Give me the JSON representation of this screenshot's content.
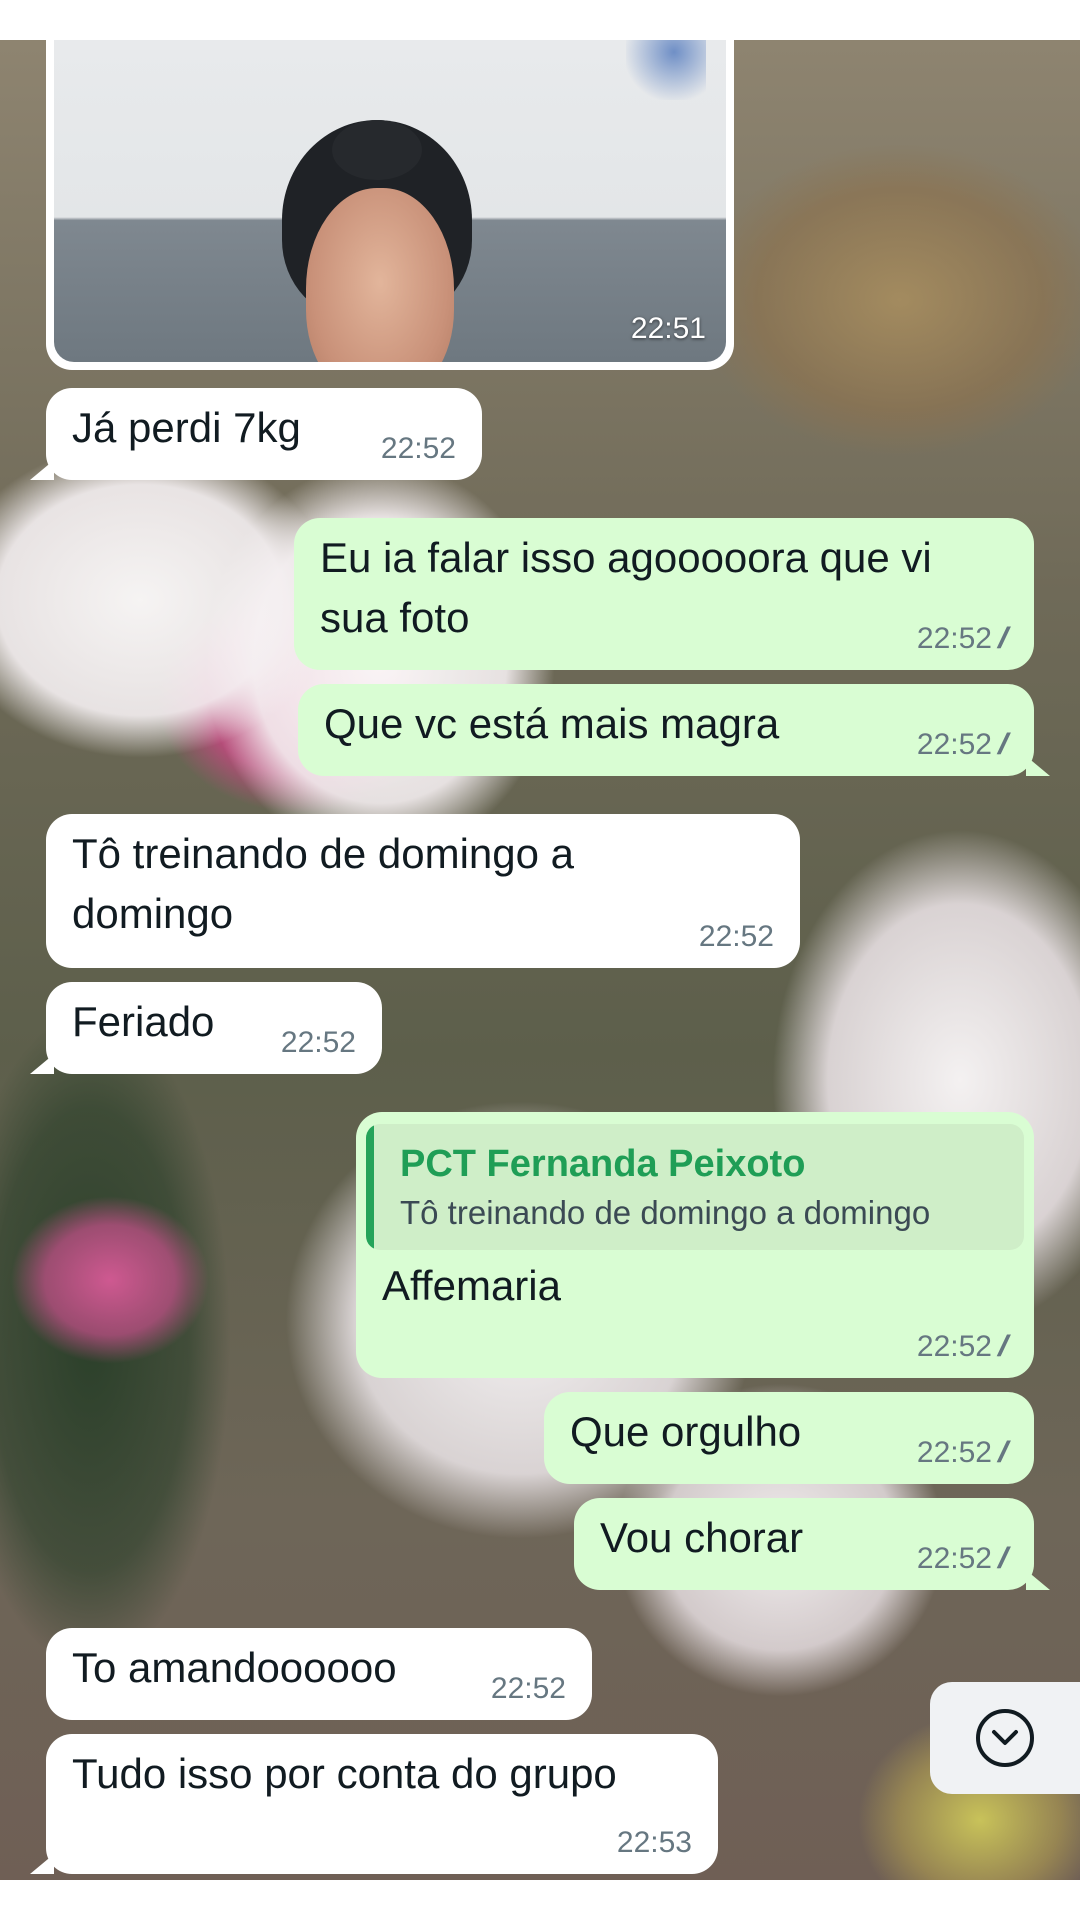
{
  "chat": {
    "photo_message": {
      "time": "22:51"
    },
    "messages": [
      {
        "direction": "in",
        "text": "Já perdi 7kg",
        "time": "22:52"
      },
      {
        "direction": "out",
        "text_line1": "Eu ia falar isso agooooora que vi",
        "text_line2": "sua foto",
        "time": "22:52",
        "status": "read"
      },
      {
        "direction": "out",
        "text": "Que vc está mais magra",
        "time": "22:52",
        "status": "read"
      },
      {
        "direction": "in",
        "text_line1": "Tô treinando de domingo a",
        "text_line2": "domingo",
        "time": "22:52"
      },
      {
        "direction": "in",
        "text": "Feriado",
        "time": "22:52"
      },
      {
        "direction": "out",
        "quote_author": "PCT Fernanda Peixoto",
        "quote_text": "Tô treinando de domingo a domingo",
        "text": "Affemaria",
        "time": "22:52",
        "status": "read"
      },
      {
        "direction": "out",
        "text": "Que orgulho",
        "time": "22:52",
        "status": "read"
      },
      {
        "direction": "out",
        "text": "Vou chorar",
        "time": "22:52",
        "status": "read"
      },
      {
        "direction": "in",
        "text": "To amandoooooo",
        "time": "22:52"
      },
      {
        "direction": "in",
        "text": "Tudo isso por conta do grupo",
        "time": "22:53"
      }
    ]
  },
  "icons": {
    "read_receipt": "double-check-icon",
    "scroll_down": "chevron-down-circle-icon"
  },
  "colors": {
    "incoming_bubble": "#ffffff",
    "outgoing_bubble": "#d9fdd3",
    "quote_accent": "#25a35a",
    "quote_author": "#1f9e56",
    "timestamp": "#667781"
  }
}
